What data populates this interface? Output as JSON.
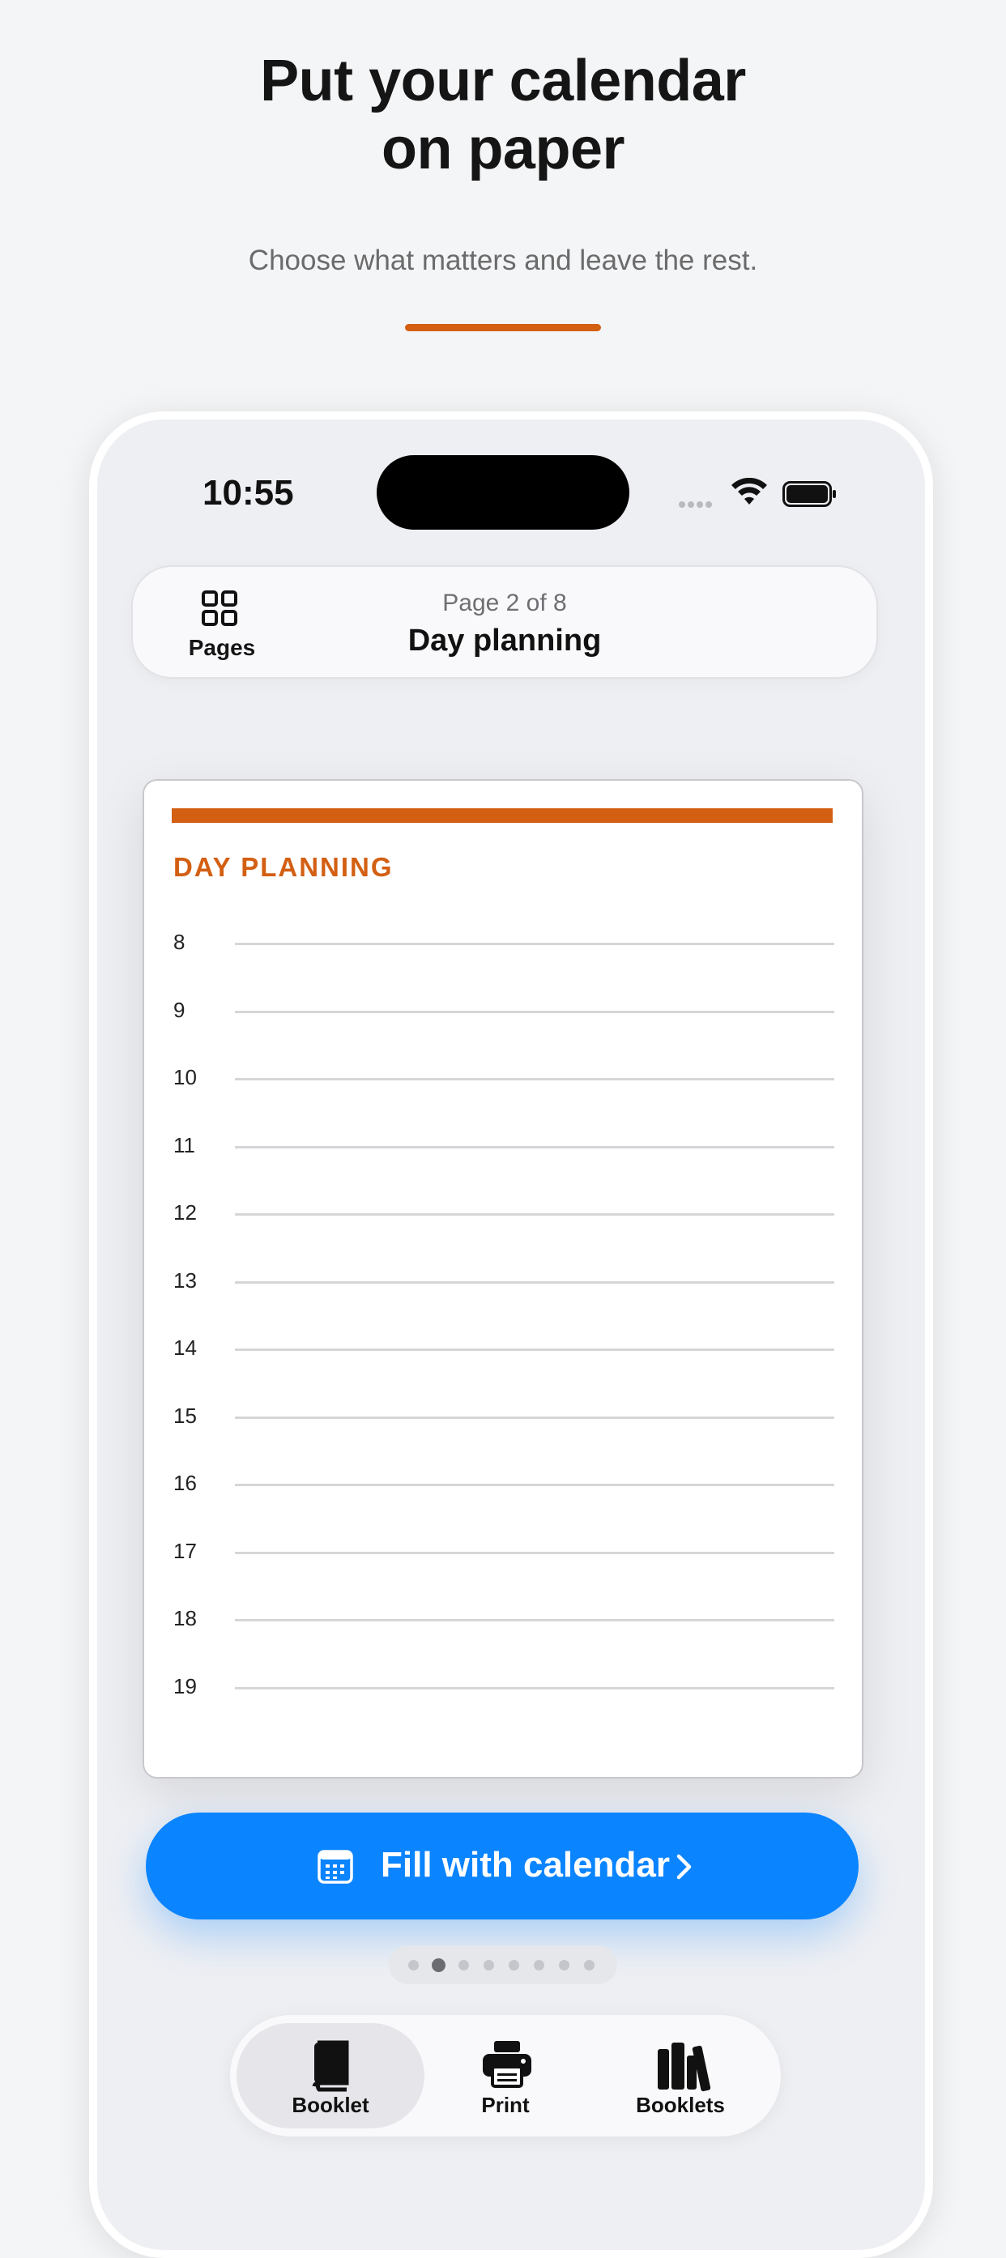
{
  "hero": {
    "title_line1": "Put your calendar",
    "title_line2": "on paper",
    "subtitle": "Choose what matters and leave the rest."
  },
  "status_bar": {
    "time": "10:55",
    "icons": [
      "signal-icon",
      "wifi-icon",
      "battery-icon"
    ]
  },
  "top_bar": {
    "pages_label": "Pages",
    "pages_icon": "grid-icon",
    "page_counter": "Page 2 of 8",
    "page_title": "Day planning"
  },
  "sheet": {
    "heading": "DAY PLANNING",
    "hours": [
      "8",
      "9",
      "10",
      "11",
      "12",
      "13",
      "14",
      "15",
      "16",
      "17",
      "18",
      "19"
    ]
  },
  "cta": {
    "label": "Fill with calendar",
    "icon": "calendar-icon"
  },
  "pager": {
    "total": 8,
    "current": 2
  },
  "tabs": [
    {
      "label": "Booklet",
      "icon": "book-icon",
      "active": true
    },
    {
      "label": "Print",
      "icon": "printer-icon",
      "active": false
    },
    {
      "label": "Booklets",
      "icon": "books-icon",
      "active": false
    }
  ],
  "colors": {
    "accent": "#d35f13",
    "primary": "#0a84ff",
    "background": "#f4f5f7"
  }
}
